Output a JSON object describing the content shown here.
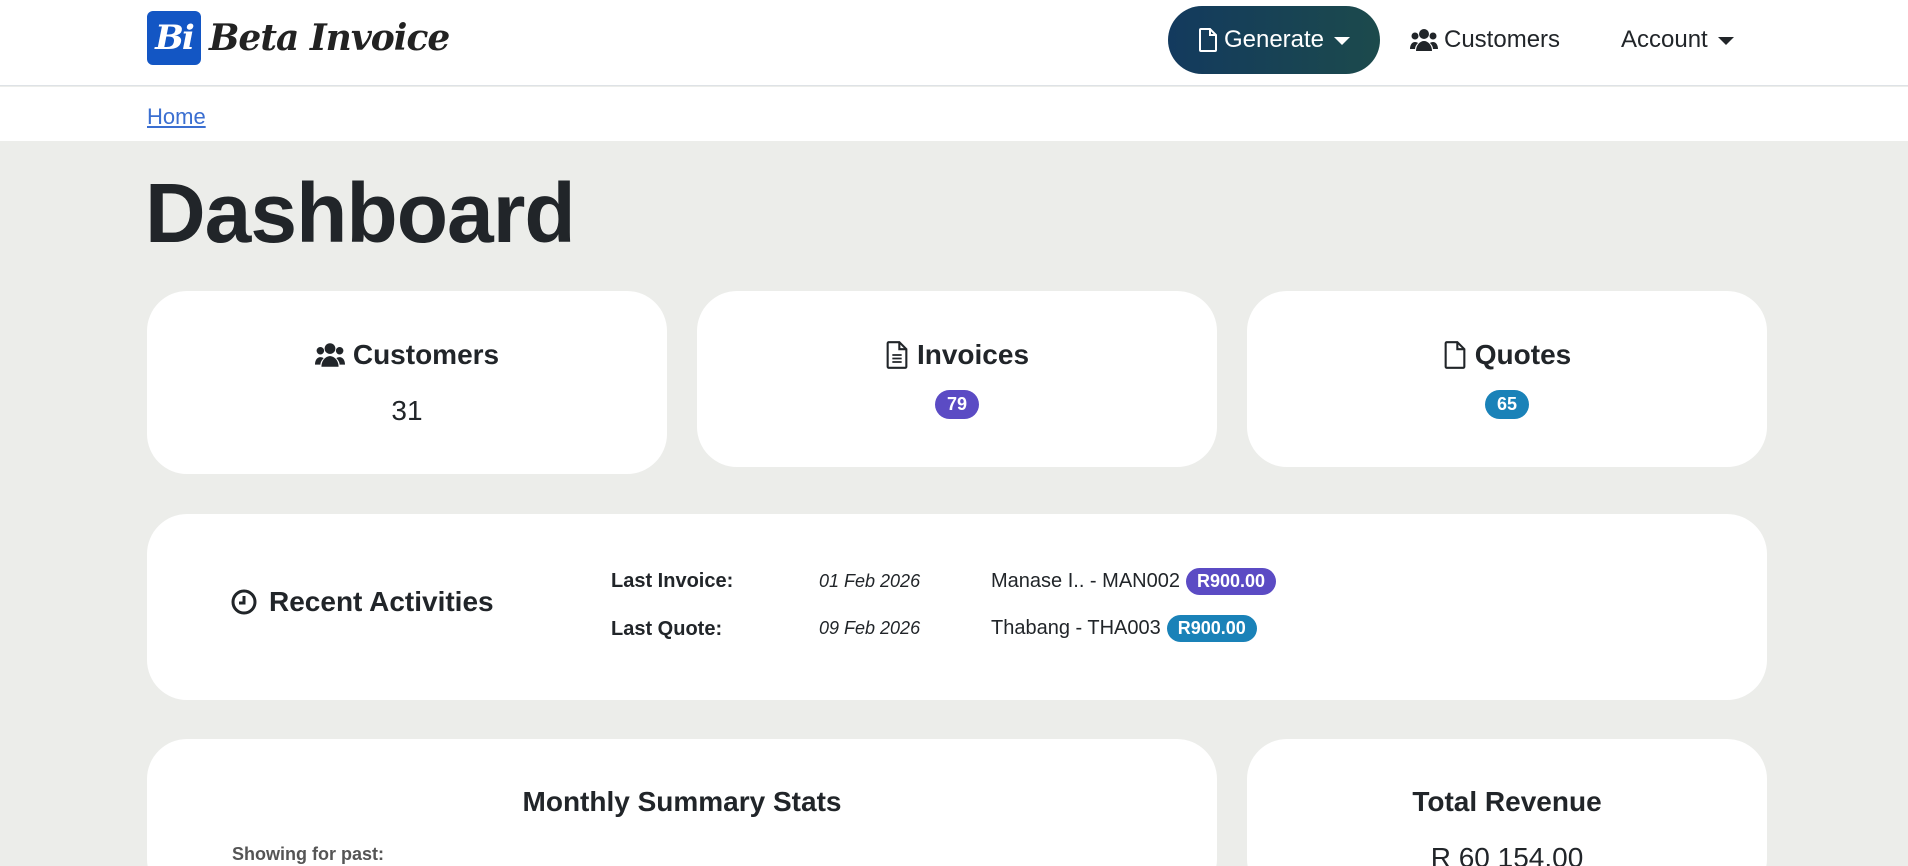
{
  "brand": {
    "logo_text": "Bi",
    "name": "Beta Invoice"
  },
  "nav": {
    "generate_label": "Generate",
    "customers_label": "Customers",
    "account_label": "Account"
  },
  "breadcrumb": {
    "home": "Home"
  },
  "page": {
    "title": "Dashboard"
  },
  "stats": {
    "customers": {
      "title": "Customers",
      "value": "31"
    },
    "invoices": {
      "title": "Invoices",
      "count": "79"
    },
    "quotes": {
      "title": "Quotes",
      "count": "65"
    }
  },
  "recent": {
    "title": "Recent Activities",
    "last_invoice": {
      "label": "Last Invoice:",
      "date": "01 Feb 2026",
      "customer": "Manase I.. - MAN002",
      "amount": "R900.00"
    },
    "last_quote": {
      "label": "Last Quote:",
      "date": "09 Feb 2026",
      "customer": "Thabang - THA003",
      "amount": "R900.00"
    }
  },
  "monthly": {
    "title": "Monthly Summary Stats",
    "showing_label": "Showing for past:"
  },
  "revenue": {
    "title": "Total Revenue",
    "value": "R 60 154.00"
  },
  "colors": {
    "invoice_badge": "#5b4bc4",
    "quote_badge": "#1a82b8",
    "link": "#3b6fd1",
    "nav_button": "#133a5e"
  }
}
